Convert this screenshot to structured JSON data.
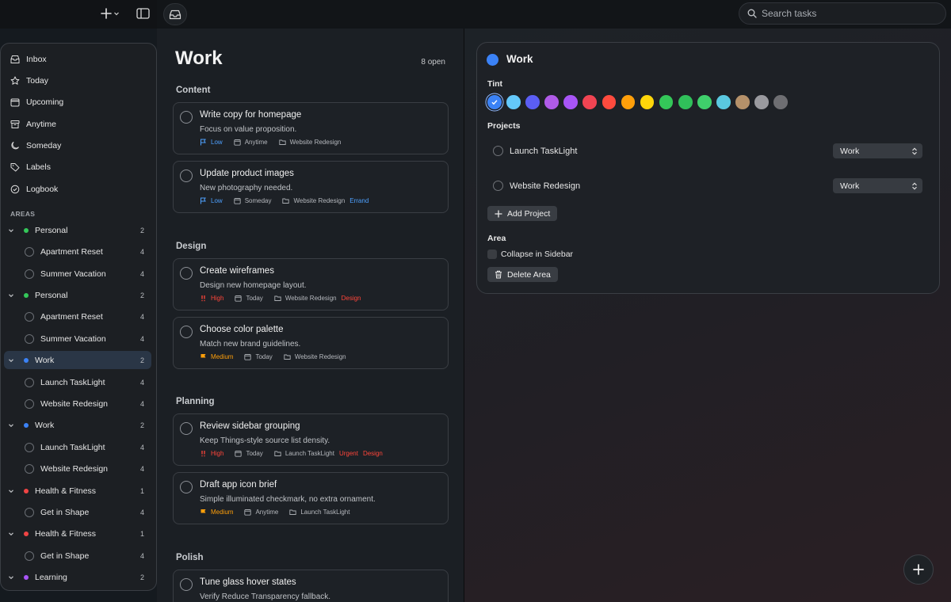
{
  "search": {
    "placeholder": "Search tasks"
  },
  "sidebar": {
    "nav": [
      "Inbox",
      "Today",
      "Upcoming",
      "Anytime",
      "Someday",
      "Labels",
      "Logbook"
    ],
    "areas_heading": "AREAS",
    "rows": [
      {
        "label": "Personal",
        "kind": "area",
        "color": "#34c759",
        "count": "2"
      },
      {
        "label": "Apartment Reset",
        "kind": "project",
        "count": "4"
      },
      {
        "label": "Summer Vacation",
        "kind": "project",
        "count": "4"
      },
      {
        "label": "Personal",
        "kind": "area",
        "color": "#34c759",
        "count": "2"
      },
      {
        "label": "Apartment Reset",
        "kind": "project",
        "count": "4"
      },
      {
        "label": "Summer Vacation",
        "kind": "project",
        "count": "4"
      },
      {
        "label": "Work",
        "kind": "area",
        "color": "#3b82f6",
        "count": "2",
        "selected": true
      },
      {
        "label": "Launch TaskLight",
        "kind": "project",
        "count": "4"
      },
      {
        "label": "Website Redesign",
        "kind": "project",
        "count": "4"
      },
      {
        "label": "Work",
        "kind": "area",
        "color": "#3b82f6",
        "count": "2"
      },
      {
        "label": "Launch TaskLight",
        "kind": "project",
        "count": "4"
      },
      {
        "label": "Website Redesign",
        "kind": "project",
        "count": "4"
      },
      {
        "label": "Health & Fitness",
        "kind": "area",
        "color": "#ef4444",
        "count": "1"
      },
      {
        "label": "Get in Shape",
        "kind": "project",
        "count": "4"
      },
      {
        "label": "Health & Fitness",
        "kind": "area",
        "color": "#ef4444",
        "count": "1"
      },
      {
        "label": "Get in Shape",
        "kind": "project",
        "count": "4"
      },
      {
        "label": "Learning",
        "kind": "area",
        "color": "#a855f7",
        "count": "2"
      }
    ]
  },
  "main": {
    "title": "Work",
    "open_count": "8 open",
    "sections": [
      "Content",
      "Design",
      "Planning",
      "Polish"
    ],
    "tasks": [
      {
        "title": "Write copy for homepage",
        "note": "Focus on value proposition.",
        "priority": "Low",
        "priority_color": "#4ea1ff",
        "when": "Anytime",
        "project": "Website Redesign",
        "tags": []
      },
      {
        "title": "Update product images",
        "note": "New photography needed.",
        "priority": "Low",
        "priority_color": "#4ea1ff",
        "when": "Someday",
        "project": "Website Redesign",
        "tags": [
          {
            "text": "Errand",
            "color": "#4ea1ff"
          }
        ]
      },
      {
        "title": "Create wireframes",
        "note": "Design new homepage layout.",
        "priority": "High",
        "priority_color": "#ff453a",
        "when": "Today",
        "project": "Website Redesign",
        "tags": [
          {
            "text": "Design",
            "color": "#ff453a"
          }
        ]
      },
      {
        "title": "Choose color palette",
        "note": "Match new brand guidelines.",
        "priority": "Medium",
        "priority_color": "#ff9f0a",
        "when": "Today",
        "project": "Website Redesign",
        "tags": []
      },
      {
        "title": "Review sidebar grouping",
        "note": "Keep Things-style source list density.",
        "priority": "High",
        "priority_color": "#ff453a",
        "when": "Today",
        "project": "Launch TaskLight",
        "tags": [
          {
            "text": "Urgent",
            "color": "#ff453a"
          },
          {
            "text": "Design",
            "color": "#ff453a"
          }
        ]
      },
      {
        "title": "Draft app icon brief",
        "note": "Simple illuminated checkmark, no extra ornament.",
        "priority": "Medium",
        "priority_color": "#ff9f0a",
        "when": "Anytime",
        "project": "Launch TaskLight",
        "tags": []
      },
      {
        "title": "Tune glass hover states",
        "note": "Verify Reduce Transparency fallback.",
        "priority": "",
        "priority_color": "",
        "when": "",
        "project": "",
        "tags": []
      }
    ]
  },
  "inspector": {
    "title": "Work",
    "color": "#3b82f6",
    "tint_label": "Tint",
    "tints": [
      "#3b82f6",
      "#64c8fa",
      "#5b5ef4",
      "#b05be8",
      "#a855f7",
      "#f04452",
      "#ff4b3e",
      "#ff9f0a",
      "#ffd60a",
      "#34c759",
      "#30c05a",
      "#3fcf6b",
      "#5ac8e0",
      "#b5916a",
      "#9a9a9f",
      "#6e6e72"
    ],
    "selected_tint": 0,
    "projects_label": "Projects",
    "projects": [
      {
        "name": "Launch TaskLight",
        "area": "Work"
      },
      {
        "name": "Website Redesign",
        "area": "Work"
      }
    ],
    "add_project": "Add Project",
    "area_label": "Area",
    "collapse_label": "Collapse in Sidebar",
    "delete_label": "Delete Area"
  }
}
